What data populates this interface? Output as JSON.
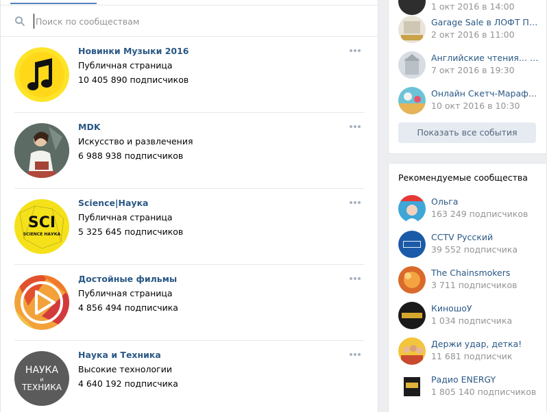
{
  "search": {
    "placeholder": "Поиск по сообществам"
  },
  "communities": [
    {
      "name": "Новинки Музыки 2016",
      "type": "Публичная страница",
      "count": "10 405 890 подписчиков"
    },
    {
      "name": "MDK",
      "type": "Искусство и развлечения",
      "count": "6 988 938 подписчиков"
    },
    {
      "name": "Science|Наука",
      "type": "Публичная страница",
      "count": "5 325 645 подписчиков"
    },
    {
      "name": "Достойные фильмы",
      "type": "Публичная страница",
      "count": "4 856 494 подписчика"
    },
    {
      "name": "Наука и Техника",
      "type": "Высокие технологии",
      "count": "4 640 192 подписчика"
    }
  ],
  "avatars": {
    "sci_text": "SCI",
    "sci_sub": "SCIENCE НАУКА",
    "nauka_line1": "НАУКА",
    "nauka_line2": "и",
    "nauka_line3": "ТЕХНИКА"
  },
  "events": {
    "top_cut": "1 окт 2016 в 14:00",
    "items": [
      {
        "title": "Garage Sale в ЛОФТ ПРОЕКТ",
        "date": "2 окт 2016 в 11:00"
      },
      {
        "title": "Английские чтения... Англия",
        "date": "7 окт 2016 в 19:30"
      },
      {
        "title": "Онлайн Скетч-Марафон.",
        "date": "10 окт 2016 в 10:30"
      }
    ],
    "show_all": "Показать все события"
  },
  "recommended": {
    "title": "Рекомендуемые сообщества",
    "items": [
      {
        "name": "Ольга",
        "count": "163 249 подписчиков"
      },
      {
        "name": "CCTV Русский",
        "count": "39 552 подписчика"
      },
      {
        "name": "The Chainsmokers",
        "count": "3 711 подписчиков"
      },
      {
        "name": "КиношоУ",
        "count": "1 034 подписчика"
      },
      {
        "name": "Держи удар, детка!",
        "count": "11 681 подписчик"
      },
      {
        "name": "Радио ENERGY",
        "count": "1 805 140 подписчиков"
      }
    ]
  },
  "colors": {
    "link": "#2a5885",
    "accent": "#5181b8",
    "muted": "#939393"
  }
}
